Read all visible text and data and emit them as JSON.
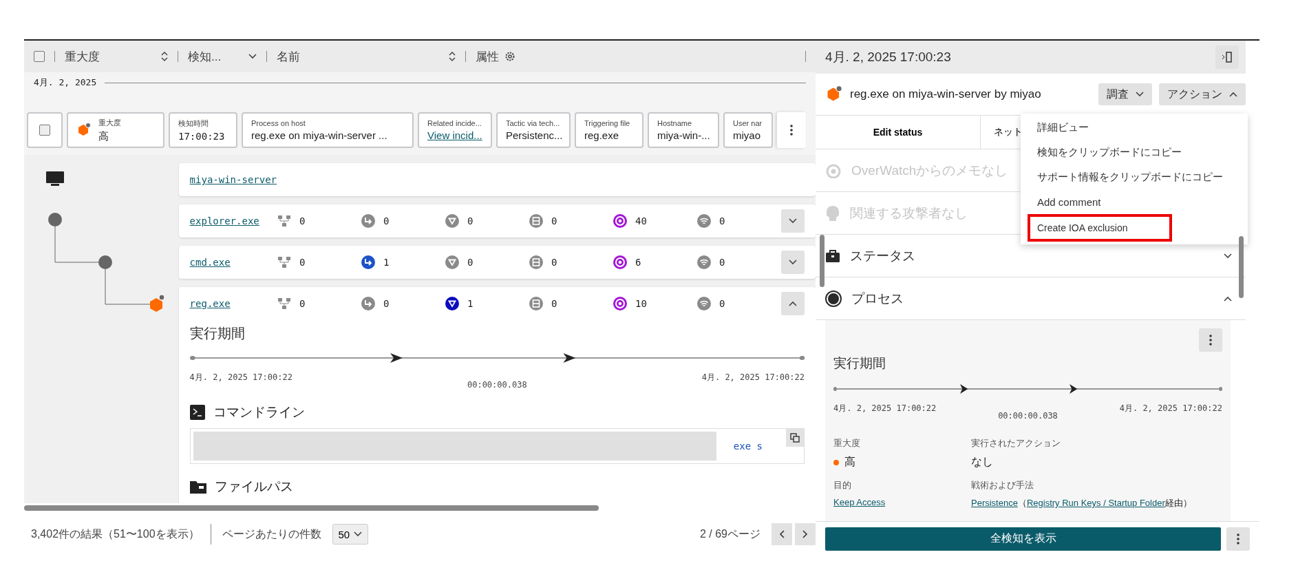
{
  "columns": [
    {
      "label": "重大度",
      "kind": "sort"
    },
    {
      "label": "検知...",
      "kind": "chevron"
    },
    {
      "label": "名前",
      "kind": "sort"
    },
    {
      "label": "属性",
      "kind": "gear"
    }
  ],
  "select_all_checked": false,
  "date_group": "4月. 2, 2025",
  "detection_card": {
    "checked": false,
    "fields": [
      {
        "label": "重大度",
        "value": "高",
        "kind": "severity"
      },
      {
        "label": "検知時間",
        "value": "17:00:23",
        "kind": "mono"
      },
      {
        "label": "Process on host",
        "value": "reg.exe on miya-win-server ...",
        "kind": "text"
      },
      {
        "label": "Related incide...",
        "value": "View incid...",
        "kind": "link"
      },
      {
        "label": "Tactic via tech...",
        "value": "Persistenc...",
        "kind": "text"
      },
      {
        "label": "Triggering file",
        "value": "reg.exe",
        "kind": "text"
      },
      {
        "label": "Hostname",
        "value": "miya-win-...",
        "kind": "text"
      },
      {
        "label": "User nar",
        "value": "miyao",
        "kind": "text"
      }
    ]
  },
  "host": "miya-win-server",
  "processes": [
    {
      "name": "explorer.exe",
      "expanded": false,
      "stats": [
        {
          "kind": "tree",
          "value": "0",
          "highlighted": false
        },
        {
          "kind": "network",
          "value": "0",
          "highlighted": false
        },
        {
          "kind": "triangle",
          "value": "0",
          "highlighted": false
        },
        {
          "kind": "disk",
          "value": "0",
          "highlighted": false
        },
        {
          "kind": "target",
          "value": "40",
          "highlighted": true
        },
        {
          "kind": "dns",
          "value": "0",
          "highlighted": false
        }
      ]
    },
    {
      "name": "cmd.exe",
      "expanded": false,
      "stats": [
        {
          "kind": "tree",
          "value": "0",
          "highlighted": false
        },
        {
          "kind": "network",
          "value": "1",
          "highlighted": true
        },
        {
          "kind": "triangle",
          "value": "0",
          "highlighted": false
        },
        {
          "kind": "disk",
          "value": "0",
          "highlighted": false
        },
        {
          "kind": "target",
          "value": "6",
          "highlighted": true
        },
        {
          "kind": "dns",
          "value": "0",
          "highlighted": false
        }
      ]
    },
    {
      "name": "reg.exe",
      "expanded": true,
      "stats": [
        {
          "kind": "tree",
          "value": "0",
          "highlighted": false
        },
        {
          "kind": "network",
          "value": "0",
          "highlighted": false
        },
        {
          "kind": "triangle",
          "value": "1",
          "highlighted": true
        },
        {
          "kind": "disk",
          "value": "0",
          "highlighted": false
        },
        {
          "kind": "target",
          "value": "10",
          "highlighted": true
        },
        {
          "kind": "dns",
          "value": "0",
          "highlighted": false
        }
      ]
    }
  ],
  "process_detail": {
    "duration_title": "実行期間",
    "start": "4月. 2, 2025 17:00:22",
    "duration": "00:00:00.038",
    "end": "4月. 2, 2025 17:00:22",
    "command_title": "コマンドライン",
    "command_tail": "exe s",
    "file_path_title": "ファイルパス"
  },
  "pagination": {
    "results": "3,402件の結果（51〜100を表示）",
    "per_page_label": "ページあたりの件数",
    "per_page": "50",
    "page": "2 / 69ページ"
  },
  "panel": {
    "timestamp": "4月. 2, 2025 17:00:23",
    "title": "reg.exe on miya-win-server by miyao",
    "investigate": "調査",
    "actions": "アクション",
    "actions_open": true,
    "tabs": [
      {
        "label": "Edit status",
        "selected": true
      },
      {
        "label": "ネット",
        "selected": false
      }
    ],
    "sections": [
      {
        "kind": "overwatch",
        "label": "OverWatchからのメモなし",
        "disabled": true
      },
      {
        "kind": "adversary",
        "label": "関連する攻撃者なし",
        "disabled": true
      },
      {
        "kind": "status",
        "label": "ステータス",
        "disabled": false,
        "expanded": false
      },
      {
        "kind": "process",
        "label": "プロセス",
        "disabled": false,
        "expanded": true
      }
    ],
    "process": {
      "duration_title": "実行期間",
      "start": "4月. 2, 2025 17:00:22",
      "duration": "00:00:00.038",
      "end": "4月. 2, 2025 17:00:22",
      "severity_label": "重大度",
      "severity": "高",
      "action_label": "実行されたアクション",
      "action": "なし",
      "objective_label": "目的",
      "objective": "Keep Access",
      "tactic_label": "戦術および手法",
      "tactic": "Persistence",
      "tactic_open": "（",
      "technique": "Registry Run Keys / Startup Folder",
      "tactic_close": "経由）"
    },
    "show_all": "全検知を表示",
    "menu": [
      {
        "label": "詳細ビュー",
        "highlighted": false
      },
      {
        "label": "検知をクリップボードにコピー",
        "highlighted": false
      },
      {
        "label": "サポート情報をクリップボードにコピー",
        "highlighted": false
      },
      {
        "label": "Add comment",
        "highlighted": false
      },
      {
        "label": "Create IOA exclusion",
        "highlighted": true
      }
    ]
  }
}
